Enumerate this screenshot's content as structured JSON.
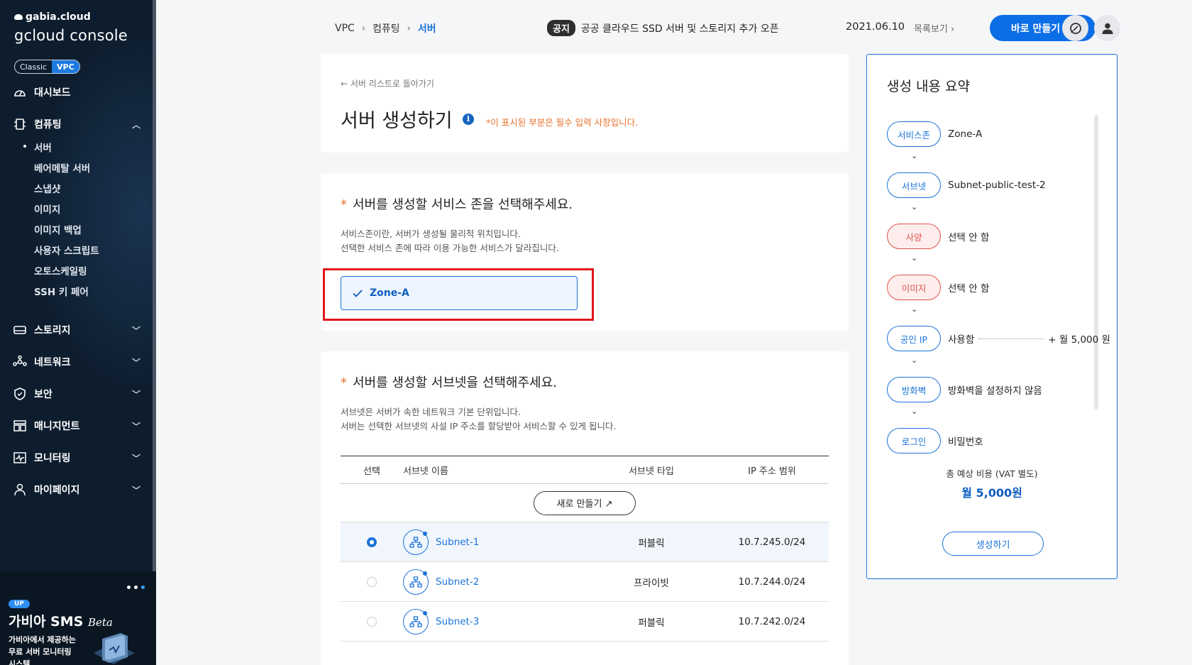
{
  "sidebar": {
    "brand_small": "gabia.cloud",
    "brand_big": "gcloud console",
    "toggle": {
      "classic": "Classic",
      "vpc": "VPC"
    },
    "dashboard": "대시보드",
    "computing": "컴퓨팅",
    "computing_items": [
      "서버",
      "베어메탈 서버",
      "스냅샷",
      "이미지",
      "이미지 백업",
      "사용자 스크립트",
      "오토스케일링",
      "SSH 키 페어"
    ],
    "storage": "스토리지",
    "network": "네트워크",
    "security": "보안",
    "management": "매니지먼트",
    "monitoring": "모니터링",
    "mypage": "마이페이지",
    "promo": {
      "badge": "UP",
      "title": "가비아 SMS",
      "title_suffix": "Beta",
      "desc_line1": "가비아에서 제공하는",
      "desc_line2": "무료 서버 모니터링",
      "desc_line3": "시스템"
    }
  },
  "topbar": {
    "breadcrumb": [
      "VPC",
      "컴퓨팅",
      "서버"
    ],
    "notice_badge": "공지",
    "notice_text": "공공 클라우드 SSD 서버 및 스토리지 추가 오픈",
    "date": "2021.06.10",
    "list_link": "목록보기",
    "make_button": "바로 만들기"
  },
  "header_card": {
    "back_link": "서버 리스트로 돌아가기",
    "title": "서버 생성하기",
    "required_note": "*이 표시된 부분은 필수 입력 사항입니다."
  },
  "zone_section": {
    "star": "*",
    "title": "서버를 생성할 서비스 존을 선택해주세요.",
    "desc_line1": "서비스존이란, 서버가 생성될 물리적 위치입니다.",
    "desc_line2": "선택한 서비스 존에 따라 이용 가능한 서비스가 달라집니다.",
    "selected_zone": "Zone-A"
  },
  "subnet_section": {
    "star": "*",
    "title": "서버를 생성할 서브넷을 선택해주세요.",
    "desc_line1": "서브넷은 서버가 속한 네트워크 기본 단위입니다.",
    "desc_line2": "서버는 선택한 서브넷의 사설 IP 주소를 할당받아 서비스할 수 있게 됩니다.",
    "columns": [
      "선택",
      "서브넷 이름",
      "서브넷 타입",
      "IP 주소 범위"
    ],
    "new_button": "새로 만들기 ↗",
    "rows": [
      {
        "name": "Subnet-1",
        "type": "퍼블릭",
        "ip": "10.7.245.0/24",
        "selected": true
      },
      {
        "name": "Subnet-2",
        "type": "프라이빗",
        "ip": "10.7.244.0/24",
        "selected": false
      },
      {
        "name": "Subnet-3",
        "type": "퍼블릭",
        "ip": "10.7.242.0/24",
        "selected": false
      }
    ]
  },
  "summary": {
    "title": "생성 내용 요약",
    "items": [
      {
        "label": "서비스존",
        "value": "Zone-A",
        "status": "ok"
      },
      {
        "label": "서브넷",
        "value": "Subnet-public-test-2",
        "status": "ok"
      },
      {
        "label": "사양",
        "value": "선택 안 함",
        "status": "warn"
      },
      {
        "label": "이미지",
        "value": "선택 안 함",
        "status": "warn"
      },
      {
        "label": "공인 IP",
        "value": "사용함",
        "extra": "+ 월 5,000 원",
        "status": "ok"
      },
      {
        "label": "방화벽",
        "value": "방화벽을 설정하지 않음",
        "status": "ok"
      },
      {
        "label": "로그인",
        "value": "비밀번호",
        "status": "ok"
      }
    ],
    "total_label": "총 예상 비용 (VAT 별도)",
    "total_value": "월 5,000원",
    "create_button": "생성하기"
  },
  "colors": {
    "accent": "#1a73d9",
    "warn": "#e0534a",
    "required": "#e8722c",
    "sidebar_bg": "#0d1d2e",
    "highlight": "#e0161c"
  }
}
